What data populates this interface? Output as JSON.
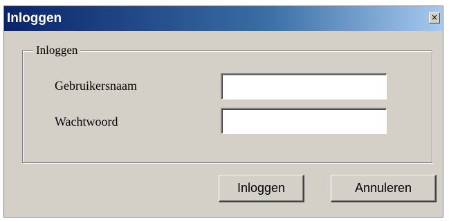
{
  "window": {
    "title": "Inloggen",
    "close_glyph": "×"
  },
  "group": {
    "legend": "Inloggen"
  },
  "fields": {
    "username_label": "Gebruikersnaam",
    "username_value": "",
    "password_label": "Wachtwoord",
    "password_value": ""
  },
  "buttons": {
    "login_label": "Inloggen",
    "cancel_label": "Annuleren"
  },
  "colors": {
    "titlebar_start": "#0a246a",
    "titlebar_end": "#a6caf0",
    "face": "#d4d0c8"
  }
}
